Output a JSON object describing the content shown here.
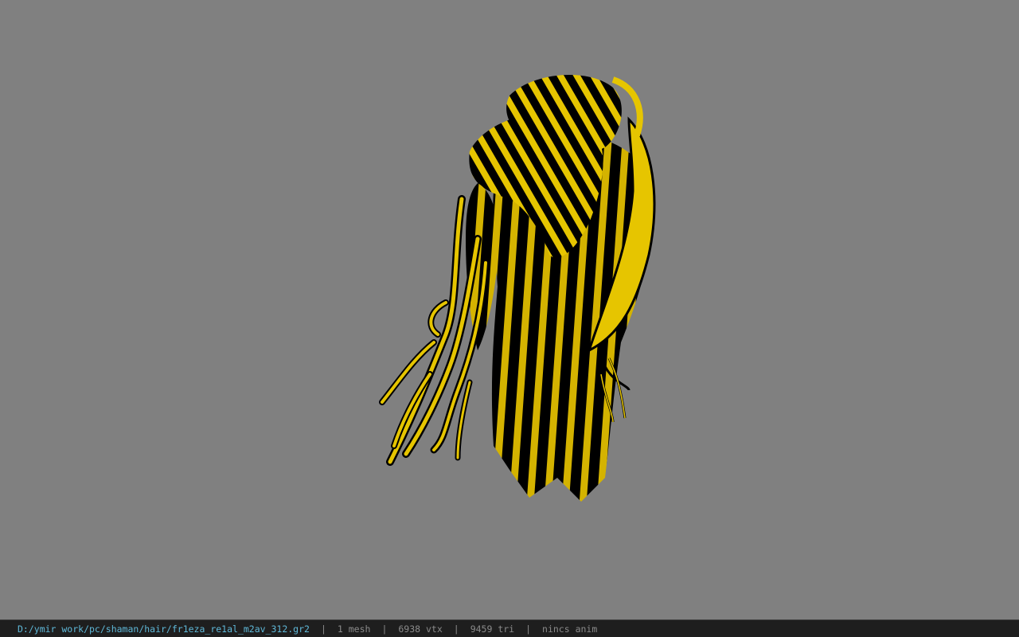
{
  "viewport": {
    "model_name": "hair-mesh",
    "background_color": "#808080",
    "hair_colors": {
      "light": "#e6c500",
      "dark": "#000000"
    }
  },
  "status_bar": {
    "file_path": "D:/ymir work/pc/shaman/hair/fr1eza_re1al_m2av_312.gr2",
    "separator": "|",
    "mesh_count": "1 mesh",
    "vertex_count": "6938 vtx",
    "triangle_count": "9459 tri",
    "anim_status": "nincs anim"
  }
}
